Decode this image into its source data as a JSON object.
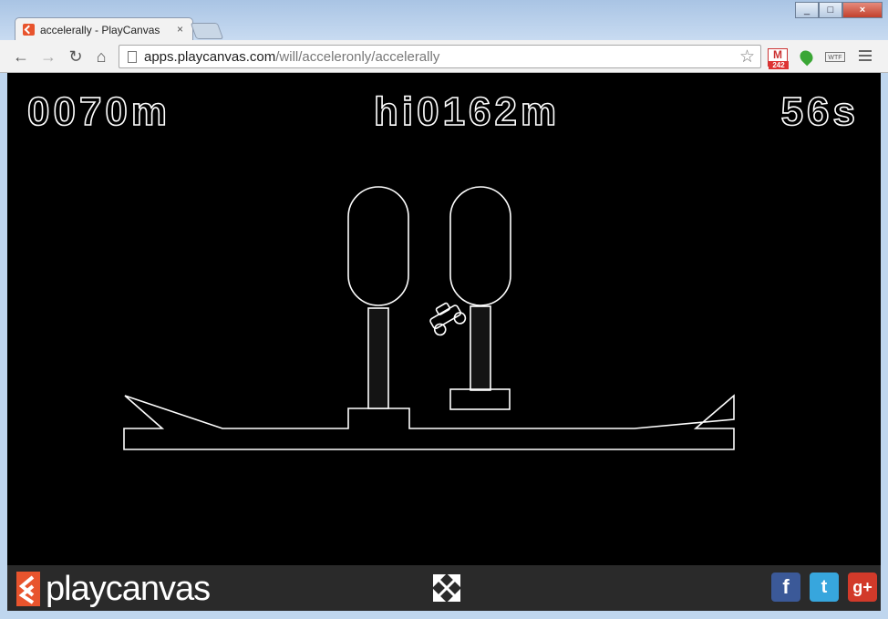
{
  "browser": {
    "tab_title": "accelerally - PlayCanvas",
    "tab_close": "×",
    "url_host": "apps.playcanvas.com",
    "url_path": "/will/acceleronly/accelerally",
    "gmail_count": "242",
    "ext_label": "WTF"
  },
  "hud": {
    "distance": "0070m",
    "high_score": "hi0162m",
    "time": "56s"
  },
  "footer": {
    "logo_text": "playcanvas",
    "facebook": "f",
    "twitter": "t",
    "google_plus": "g+"
  },
  "colors": {
    "game_bg": "#000000",
    "game_stroke": "#ffffff",
    "footer_bg": "#2a2a2a",
    "brand_orange": "#e8542d"
  },
  "icons": [
    "back-arrow-icon",
    "forward-arrow-icon",
    "reload-icon",
    "home-icon",
    "page-icon",
    "star-icon",
    "gmail-icon",
    "leaf-icon",
    "menu-icon",
    "fullscreen-icon",
    "facebook-icon",
    "twitter-icon",
    "google-plus-icon"
  ]
}
